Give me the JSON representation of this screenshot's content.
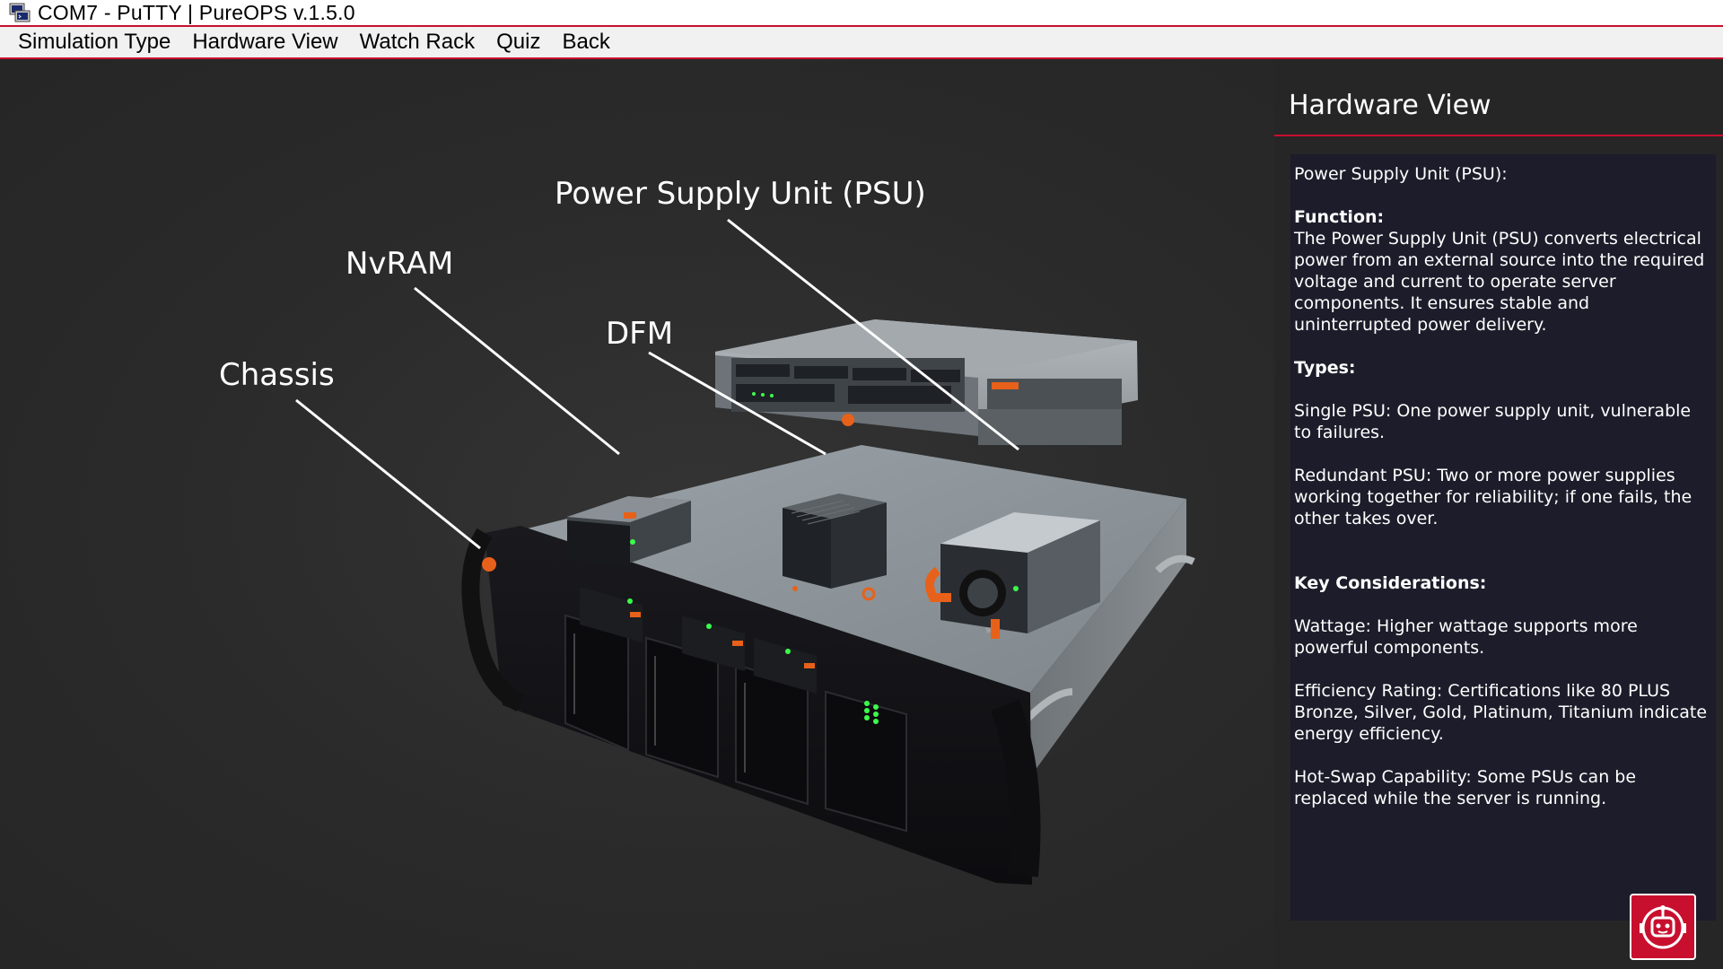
{
  "window": {
    "title": "COM7 - PuTTY | PureOPS v.1.5.0",
    "app_icon": "putty-terminal-icon"
  },
  "menu": {
    "items": [
      {
        "label": "Simulation Type"
      },
      {
        "label": "Hardware View"
      },
      {
        "label": "Watch Rack"
      },
      {
        "label": "Quiz"
      },
      {
        "label": "Back"
      }
    ]
  },
  "scene": {
    "callouts": {
      "psu": "Power Supply Unit (PSU)",
      "nvram": "NvRAM",
      "dfm": "DFM",
      "chassis": "Chassis"
    }
  },
  "panel": {
    "title": "Hardware View",
    "component": "Power Supply Unit (PSU):",
    "function_heading": "Function:",
    "function_text": "The Power Supply Unit (PSU) converts electrical power from an external source into the required voltage and current to operate server components. It ensures stable and uninterrupted power delivery.",
    "types_heading": "Types:",
    "types": [
      "Single PSU: One power supply unit, vulnerable to failures.",
      "Redundant PSU: Two or more power supplies working together for reliability; if one fails, the other takes over."
    ],
    "considerations_heading": "Key Considerations:",
    "considerations": [
      "Wattage: Higher wattage supports more powerful components.",
      "Efficiency Rating: Certifications like 80 PLUS Bronze, Silver, Gold, Platinum, Titanium indicate energy efficiency.",
      "Hot-Swap Capability: Some PSUs can be replaced while the server is running."
    ]
  },
  "assistant": {
    "icon": "robot-assistant-icon",
    "color": "#c8102e"
  },
  "colors": {
    "accent": "#c8102e",
    "background": "#2b2b2b",
    "panel_body": "#1d1c2a",
    "led_green": "#3aff4a",
    "handle_orange": "#e8611a"
  }
}
